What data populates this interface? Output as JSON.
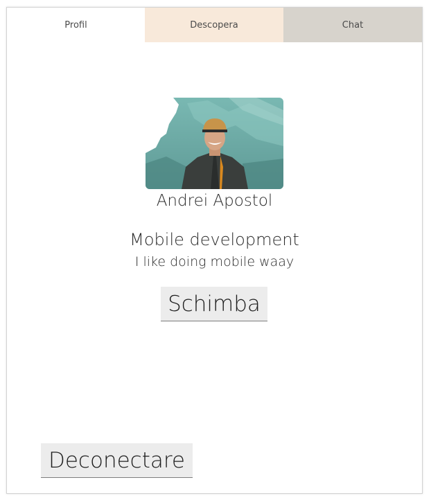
{
  "tabs": [
    {
      "label": "Profil"
    },
    {
      "label": "Descopera"
    },
    {
      "label": "Chat"
    }
  ],
  "profile": {
    "name": "Andrei Apostol",
    "title": "Mobile development",
    "bio": "I like doing mobile waay",
    "change_button": "Schimba"
  },
  "logout_button": "Deconectare",
  "colors": {
    "tab_active": "#ffffff",
    "tab_discover": "#f8e9da",
    "tab_chat": "#d7d3cc",
    "button_bg": "#ececec"
  }
}
